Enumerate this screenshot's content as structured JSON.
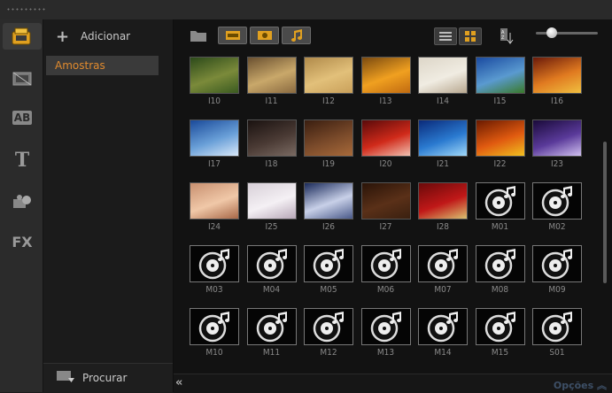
{
  "panel": {
    "add_label": "Adicionar",
    "folders": [
      "Amostras"
    ],
    "browse_label": "Procurar"
  },
  "footer": {
    "options_label": "Opções",
    "collapse_glyph": "«"
  },
  "icons": {
    "left": [
      "media-library-icon",
      "video-filter-icon",
      "transition-icon",
      "title-icon",
      "graphic-icon",
      "fx-filter-icon"
    ],
    "left_text": {
      "transition": "AB",
      "title": "T",
      "fx": "FX"
    }
  },
  "toolbar": {
    "media_filters": [
      "video-filter",
      "image-filter",
      "audio-filter"
    ],
    "view_modes": [
      "list-view",
      "thumbnail-view"
    ],
    "zoom_level": 0.2
  },
  "colors": {
    "accent": "#e08a2e",
    "options": "#3d4f66"
  },
  "items": [
    {
      "label": "I10",
      "kind": "image",
      "colors": [
        "#2c4a1a",
        "#7b8a3a",
        "#3a5a20"
      ]
    },
    {
      "label": "I11",
      "kind": "image",
      "colors": [
        "#6a5030",
        "#c9a86a",
        "#8a6a40"
      ]
    },
    {
      "label": "I12",
      "kind": "image",
      "colors": [
        "#b08a4a",
        "#e2c07a",
        "#c9a05a"
      ]
    },
    {
      "label": "I13",
      "kind": "image",
      "colors": [
        "#7a4a10",
        "#f0a020",
        "#c06a10"
      ]
    },
    {
      "label": "I14",
      "kind": "image",
      "colors": [
        "#ddd6c8",
        "#f0ece2",
        "#b8a890"
      ]
    },
    {
      "label": "I15",
      "kind": "image",
      "colors": [
        "#1a4aa0",
        "#5a9ad0",
        "#3a7a2a"
      ]
    },
    {
      "label": "I16",
      "kind": "image",
      "colors": [
        "#6a1a0a",
        "#e07a20",
        "#f0c040"
      ]
    },
    {
      "label": "I17",
      "kind": "image",
      "colors": [
        "#1a4a9a",
        "#6aa0d8",
        "#d8e8f8"
      ]
    },
    {
      "label": "I18",
      "kind": "image",
      "colors": [
        "#1a1210",
        "#4a3a34",
        "#7a6a62"
      ]
    },
    {
      "label": "I19",
      "kind": "image",
      "colors": [
        "#3a1e10",
        "#7a4a2a",
        "#a86a3a"
      ]
    },
    {
      "label": "I20",
      "kind": "image",
      "colors": [
        "#5a0a0a",
        "#d02a1a",
        "#f0c0b0"
      ]
    },
    {
      "label": "I21",
      "kind": "image",
      "colors": [
        "#0a2a7a",
        "#2a7ad0",
        "#a0d8f8"
      ]
    },
    {
      "label": "I22",
      "kind": "image",
      "colors": [
        "#6a1a00",
        "#e05a10",
        "#f0c020"
      ]
    },
    {
      "label": "I23",
      "kind": "image",
      "colors": [
        "#1a0a3a",
        "#5a3a9a",
        "#d0c0f0"
      ]
    },
    {
      "label": "I24",
      "kind": "image",
      "colors": [
        "#c89070",
        "#f0c8a8",
        "#a86848"
      ]
    },
    {
      "label": "I25",
      "kind": "image",
      "colors": [
        "#d8d0d8",
        "#f4f0f4",
        "#b8a8b8"
      ]
    },
    {
      "label": "I26",
      "kind": "image",
      "colors": [
        "#1a2a5a",
        "#c8d0e8",
        "#4a5a8a"
      ]
    },
    {
      "label": "I27",
      "kind": "image",
      "colors": [
        "#2a1408",
        "#5a3018",
        "#3a2010"
      ]
    },
    {
      "label": "I28",
      "kind": "image",
      "colors": [
        "#6a0a0a",
        "#c01818",
        "#d8c070"
      ]
    },
    {
      "label": "M01",
      "kind": "music"
    },
    {
      "label": "M02",
      "kind": "music"
    },
    {
      "label": "M03",
      "kind": "music"
    },
    {
      "label": "M04",
      "kind": "music"
    },
    {
      "label": "M05",
      "kind": "music"
    },
    {
      "label": "M06",
      "kind": "music"
    },
    {
      "label": "M07",
      "kind": "music"
    },
    {
      "label": "M08",
      "kind": "music"
    },
    {
      "label": "M09",
      "kind": "music"
    },
    {
      "label": "M10",
      "kind": "music"
    },
    {
      "label": "M11",
      "kind": "music"
    },
    {
      "label": "M12",
      "kind": "music"
    },
    {
      "label": "M13",
      "kind": "music"
    },
    {
      "label": "M14",
      "kind": "music"
    },
    {
      "label": "M15",
      "kind": "music"
    },
    {
      "label": "S01",
      "kind": "music"
    }
  ]
}
